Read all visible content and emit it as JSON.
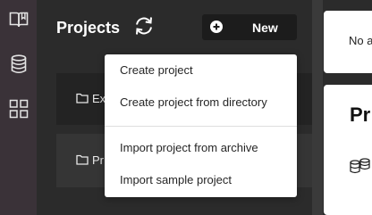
{
  "rail": {
    "items": [
      {
        "icon": "book-icon"
      },
      {
        "icon": "database-icon"
      },
      {
        "icon": "grid-icon"
      }
    ]
  },
  "panel": {
    "title": "Projects",
    "new_label": "New",
    "projects": [
      {
        "name": "Ex"
      },
      {
        "name": "Pr"
      }
    ]
  },
  "menu": {
    "items": [
      "Create project",
      "Create project from directory",
      "Import project from archive",
      "Import sample project"
    ]
  },
  "right": {
    "card1_text": "No a",
    "card2_title": "Pr"
  }
}
